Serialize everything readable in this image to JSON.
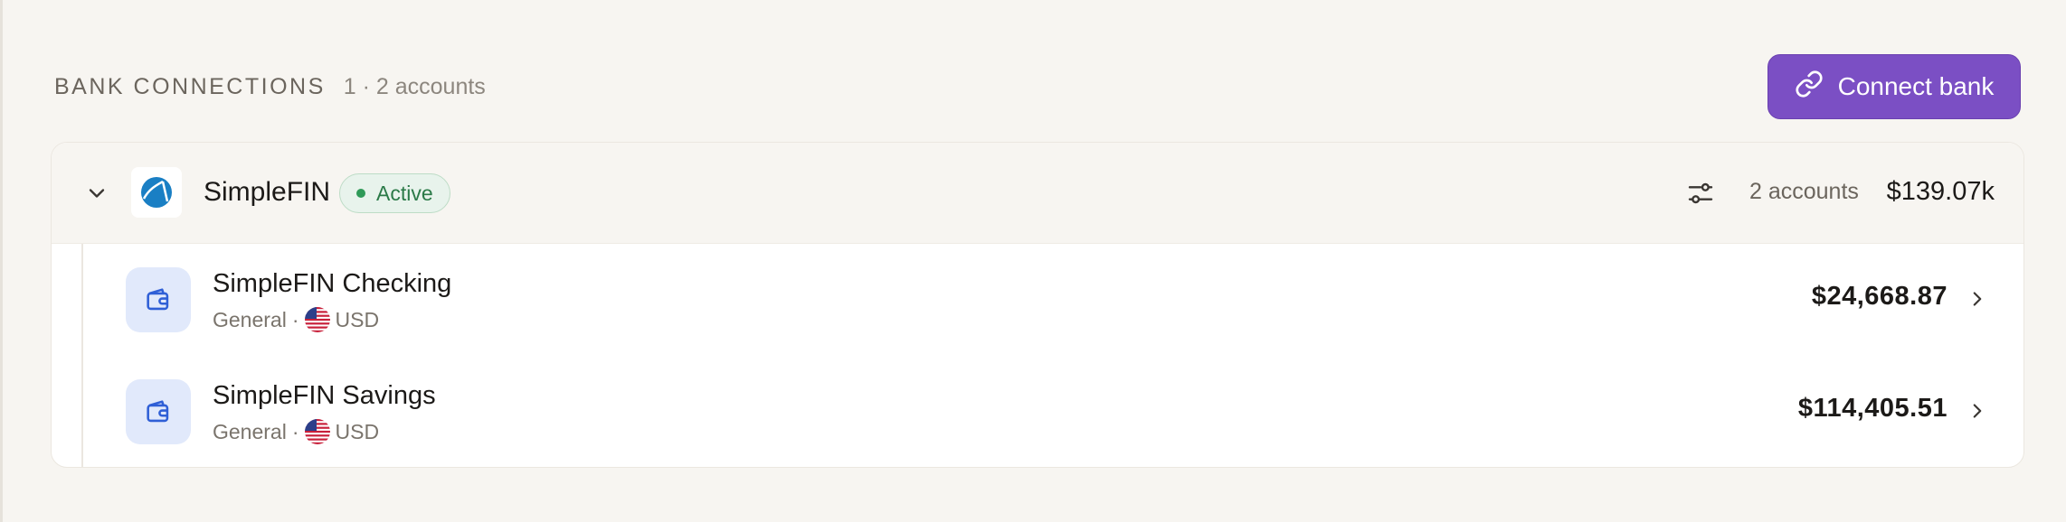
{
  "section": {
    "title": "BANK CONNECTIONS",
    "count": "1 · 2 accounts",
    "connect_label": "Connect bank"
  },
  "connection": {
    "name": "SimpleFIN",
    "status": "Active",
    "accounts_label": "2 accounts",
    "total": "$139.07k",
    "colors": {
      "accent": "#7b4fc4",
      "status": "#2b7a48",
      "logo": "#1a7fc4"
    }
  },
  "accounts": [
    {
      "name": "SimpleFIN Checking",
      "type": "General",
      "separator": " · ",
      "currency": "USD",
      "amount": "$24,668.87"
    },
    {
      "name": "SimpleFIN Savings",
      "type": "General",
      "separator": " · ",
      "currency": "USD",
      "amount": "$114,405.51"
    }
  ]
}
